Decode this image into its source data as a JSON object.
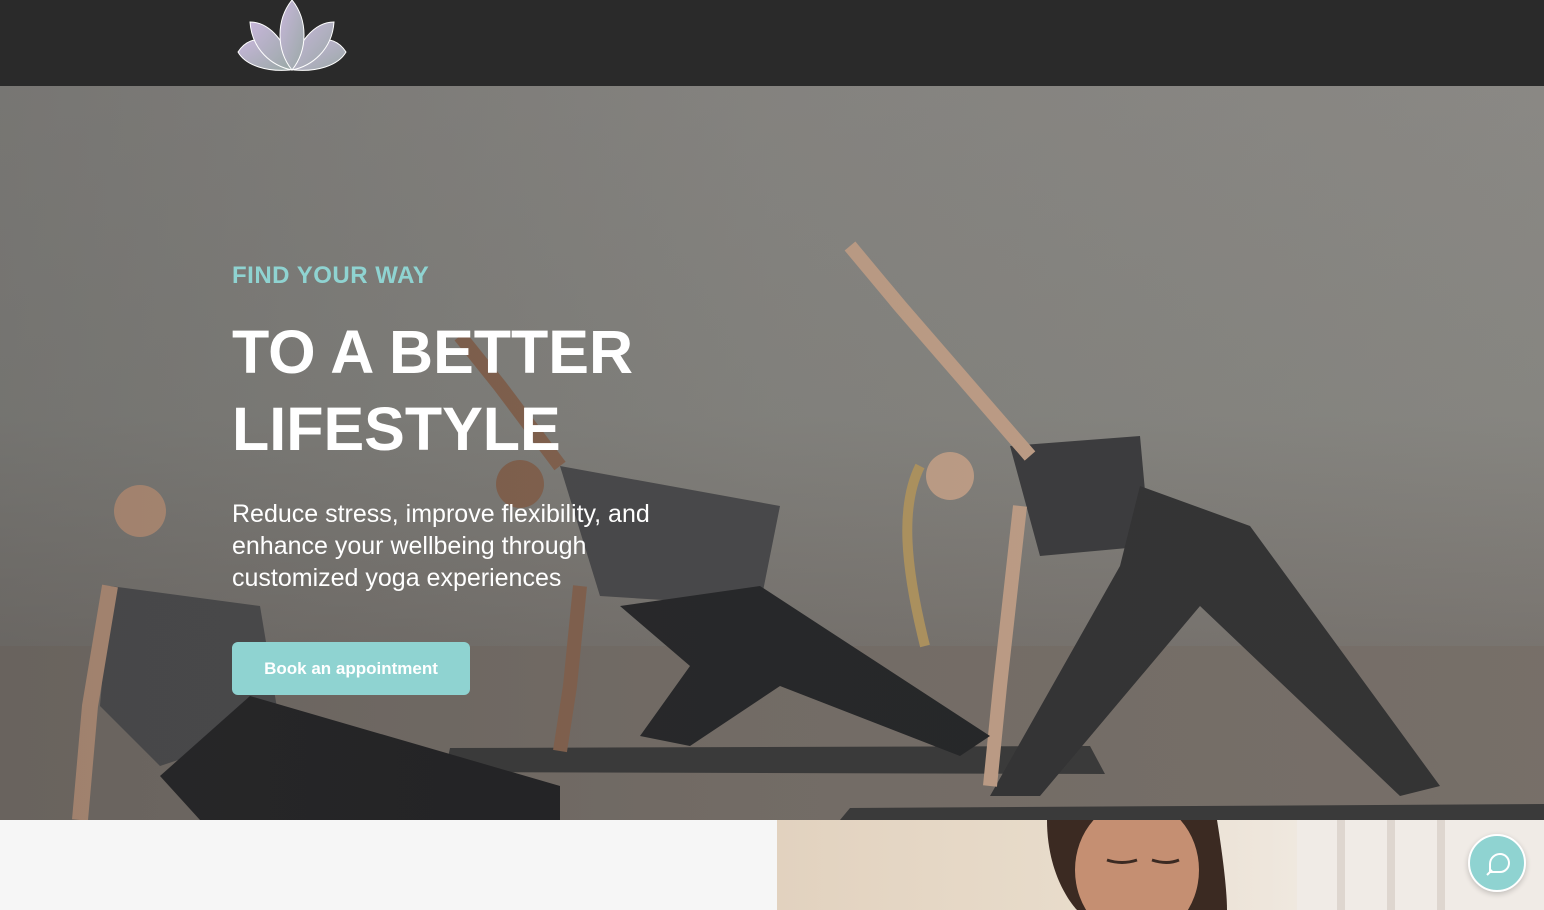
{
  "header": {
    "logo_icon": "lotus-icon"
  },
  "hero": {
    "eyebrow": "FIND YOUR WAY",
    "headline": "TO A BETTER LIFESTYLE",
    "subtitle": "Reduce stress, improve flexibility, and enhance your wellbeing through customized yoga experiences",
    "cta_label": "Book an appointment"
  },
  "chat": {
    "icon": "chat-bubble-icon"
  },
  "colors": {
    "accent": "#8fd3d1",
    "header_bg": "#2a2a2a",
    "text_light": "#ffffff",
    "lotus": "#b3a3c9"
  }
}
